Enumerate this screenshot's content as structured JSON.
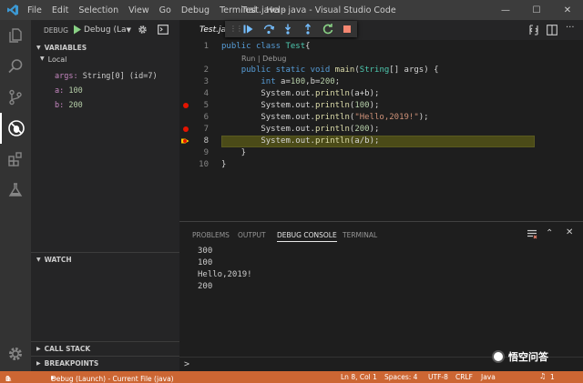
{
  "window": {
    "title": "Test.java - java - Visual Studio Code",
    "menu": [
      "File",
      "Edit",
      "Selection",
      "View",
      "Go",
      "Debug",
      "Terminal",
      "Help"
    ]
  },
  "sidebar": {
    "debug_label": "DEBUG",
    "config_select": "Debug (La",
    "variables": {
      "header": "VARIABLES",
      "scope": "Local",
      "items": [
        {
          "name": "args:",
          "value": "String[0] (id=7)"
        },
        {
          "name": "a:",
          "value": "100"
        },
        {
          "name": "b:",
          "value": "200"
        }
      ]
    },
    "watch_header": "WATCH",
    "call_stack_header": "CALL STACK",
    "breakpoints_header": "BREAKPOINTS"
  },
  "editor": {
    "tab_label": "Test.java",
    "codelens": "Run | Debug",
    "lines": [
      {
        "n": "1",
        "tokens": [
          [
            "kw",
            "public"
          ],
          [
            "t",
            " "
          ],
          [
            "kw",
            "class"
          ],
          [
            "t",
            " "
          ],
          [
            "cls",
            "Test"
          ],
          [
            "t",
            "{"
          ]
        ]
      },
      {
        "n": "2",
        "tokens": [
          [
            "t",
            "    "
          ],
          [
            "kw",
            "public"
          ],
          [
            "t",
            " "
          ],
          [
            "kw",
            "static"
          ],
          [
            "t",
            " "
          ],
          [
            "kw",
            "void"
          ],
          [
            "t",
            " "
          ],
          [
            "fn",
            "main"
          ],
          [
            "t",
            "("
          ],
          [
            "cls",
            "String"
          ],
          [
            "t",
            "[] args) {"
          ]
        ]
      },
      {
        "n": "3",
        "tokens": [
          [
            "t",
            "        "
          ],
          [
            "kw",
            "int"
          ],
          [
            "t",
            " a="
          ],
          [
            "num",
            "100"
          ],
          [
            "t",
            ",b="
          ],
          [
            "num",
            "200"
          ],
          [
            "t",
            ";"
          ]
        ]
      },
      {
        "n": "4",
        "tokens": [
          [
            "t",
            "        System.out."
          ],
          [
            "fn",
            "println"
          ],
          [
            "t",
            "(a+b);"
          ]
        ]
      },
      {
        "n": "5",
        "tokens": [
          [
            "t",
            "        System.out."
          ],
          [
            "fn",
            "println"
          ],
          [
            "t",
            "("
          ],
          [
            "num",
            "100"
          ],
          [
            "t",
            ");"
          ]
        ]
      },
      {
        "n": "6",
        "tokens": [
          [
            "t",
            "        System.out."
          ],
          [
            "fn",
            "println"
          ],
          [
            "t",
            "("
          ],
          [
            "str",
            "\"Hello,2019!\""
          ],
          [
            "t",
            ");"
          ]
        ]
      },
      {
        "n": "7",
        "tokens": [
          [
            "t",
            "        System.out."
          ],
          [
            "fn",
            "println"
          ],
          [
            "t",
            "("
          ],
          [
            "num",
            "200"
          ],
          [
            "t",
            ");"
          ]
        ]
      },
      {
        "n": "8",
        "tokens": [
          [
            "t",
            "        System.out."
          ],
          [
            "fn",
            "println"
          ],
          [
            "t",
            "(a/b);"
          ]
        ]
      },
      {
        "n": "9",
        "tokens": [
          [
            "t",
            "    }"
          ]
        ]
      },
      {
        "n": "10",
        "tokens": [
          [
            "t",
            "}"
          ]
        ]
      }
    ],
    "breakpoint_lines": [
      "5",
      "7"
    ],
    "current_line": "8"
  },
  "panel": {
    "tabs": [
      "PROBLEMS",
      "OUTPUT",
      "DEBUG CONSOLE",
      "TERMINAL"
    ],
    "active_tab": "DEBUG CONSOLE",
    "console_output": [
      "300",
      "100",
      "Hello,2019!",
      "200"
    ],
    "prompt": ">"
  },
  "statusbar": {
    "errors": "0",
    "warnings": "0",
    "debug_target": "Debug (Launch) - Current File (java)",
    "position": "Ln 8, Col 1",
    "spaces": "Spaces: 4",
    "encoding": "UTF-8",
    "eol": "CRLF",
    "language": "Java",
    "notifications": "1",
    "watermark": "悟空问答"
  },
  "colors": {
    "statusbar": "#cc6633",
    "keyword": "#569cd6",
    "class": "#4ec9b0",
    "function": "#dcdcaa",
    "number": "#b5cea8",
    "string": "#ce9178",
    "breakpoint": "#e51400",
    "current_line_bg": "#4b4b18"
  },
  "icons": [
    "vscode-logo-icon",
    "files-icon",
    "search-icon",
    "source-control-icon",
    "debug-icon",
    "extensions-icon",
    "test-flask-icon",
    "gear-icon"
  ]
}
